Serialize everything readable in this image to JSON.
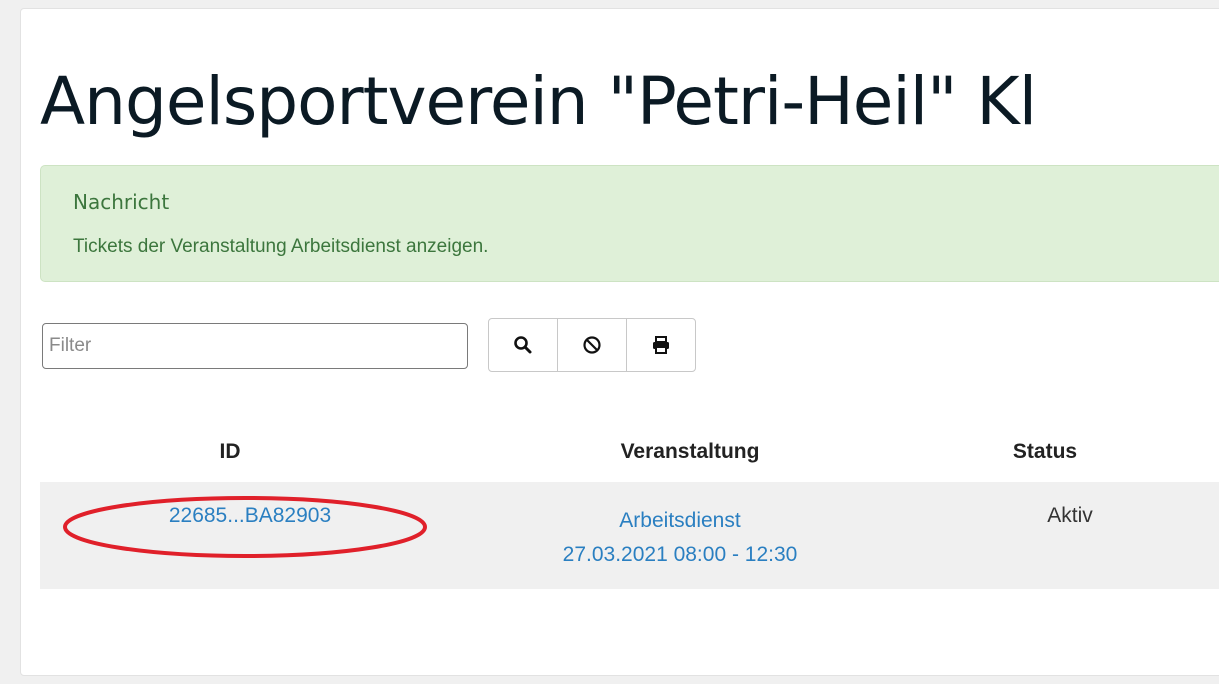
{
  "header": {
    "title": "Angelsportverein \"Petri-Heil\" Kl"
  },
  "alert": {
    "title": "Nachricht",
    "text": "Tickets der Veranstaltung Arbeitsdienst anzeigen."
  },
  "filter": {
    "placeholder": "Filter",
    "value": ""
  },
  "toolbar": {
    "search_icon": "search-icon",
    "clear_icon": "ban-icon",
    "print_icon": "print-icon"
  },
  "table": {
    "columns": [
      "ID",
      "Veranstaltung",
      "Status"
    ],
    "rows": [
      {
        "id": "22685...BA82903",
        "event_name": "Arbeitsdienst",
        "event_time": "27.03.2021 08:00 - 12:30",
        "status": "Aktiv"
      }
    ]
  },
  "colors": {
    "alert_bg": "#dff0d8",
    "alert_text": "#3c763d",
    "link": "#2a7fc1",
    "highlight": "#e0202a"
  }
}
